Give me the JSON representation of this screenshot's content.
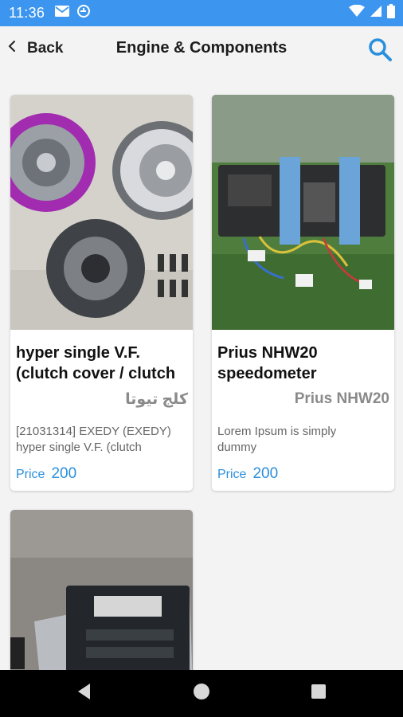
{
  "status_bar": {
    "time": "11:36"
  },
  "header": {
    "back_label": "Back",
    "title": "Engine & Components"
  },
  "products": [
    {
      "title_lines": [
        "hyper single V.F.",
        "(clutch cover / clutch"
      ],
      "subtitle": "كلج تيوتا",
      "desc_lines": [
        "[21031314] EXEDY (EXEDY)",
        "hyper single V.F. (clutch"
      ],
      "price_label": "Price",
      "price": "200",
      "image": "clutch-kit-photo"
    },
    {
      "title_lines": [
        "Prius NHW20",
        "speedometer"
      ],
      "subtitle": "Prius NHW20",
      "desc_lines": [
        "Lorem Ipsum is simply",
        "dummy"
      ],
      "price_label": "Price",
      "price": "200",
      "image": "speedometer-cluster-photo"
    },
    {
      "image": "ecu-module-photo"
    }
  ],
  "colors": {
    "status_bar": "#3c96f0",
    "accent": "#2a8fdc",
    "subtitle": "#8a8a8a"
  }
}
